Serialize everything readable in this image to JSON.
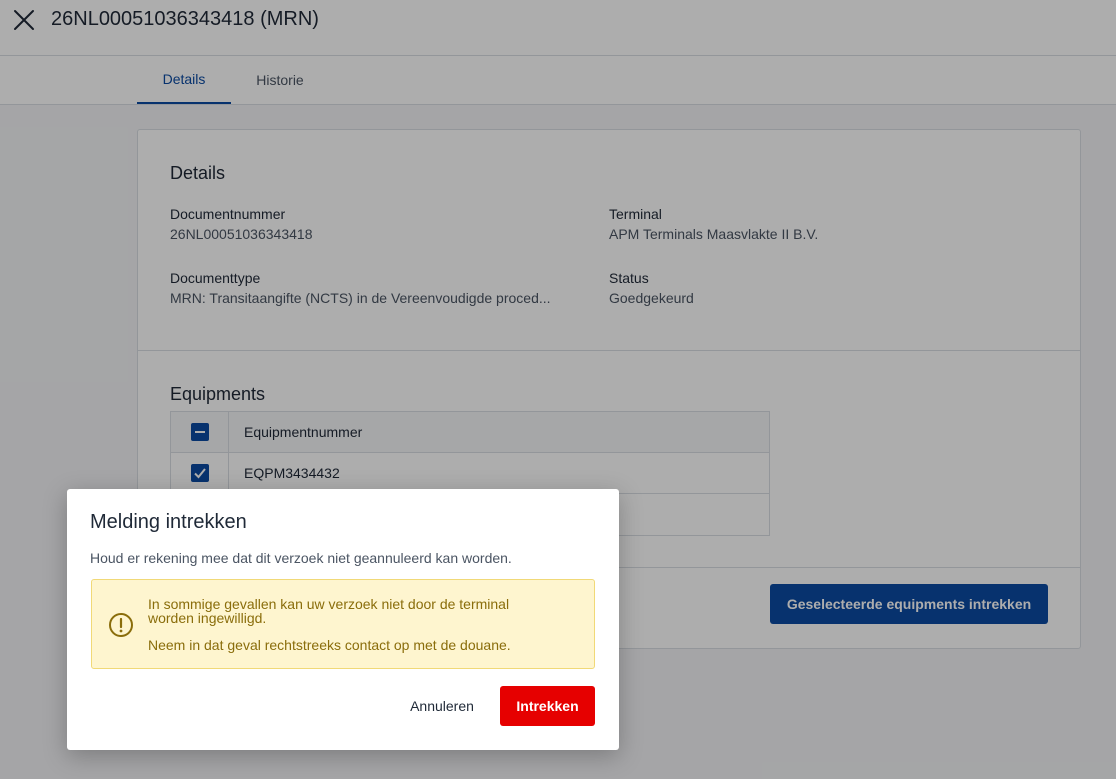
{
  "header": {
    "title": "26NL00051036343418 (MRN)",
    "close_icon": "close-icon"
  },
  "tabs": [
    {
      "label": "Details",
      "active": true
    },
    {
      "label": "Historie",
      "active": false
    }
  ],
  "details": {
    "title": "Details",
    "fields": {
      "documentnummer": {
        "label": "Documentnummer",
        "value": "26NL00051036343418"
      },
      "terminal": {
        "label": "Terminal",
        "value": "APM Terminals Maasvlakte II B.V."
      },
      "documenttype": {
        "label": "Documenttype",
        "value": "MRN: Transitaangifte (NCTS) in de Vereenvoudigde proced..."
      },
      "status": {
        "label": "Status",
        "value": "Goedgekeurd"
      }
    }
  },
  "equipments": {
    "title": "Equipments",
    "column_header": "Equipmentnummer",
    "rows": [
      {
        "number": "EQPM3434432",
        "checked": true
      },
      {
        "number": "",
        "checked": false
      }
    ],
    "withdraw_button": "Geselecteerde equipments intrekken"
  },
  "modal": {
    "title": "Melding intrekken",
    "text": "Houd er rekening mee dat dit verzoek niet geannuleerd kan worden.",
    "alert": {
      "line1": "In sommige gevallen kan uw verzoek niet door de terminal",
      "line2": "worden ingewilligd.",
      "line3": "Neem in dat geval rechtstreeks contact op met de douane."
    },
    "cancel_label": "Annuleren",
    "confirm_label": "Intrekken"
  },
  "colors": {
    "primary": "#0b4aa2",
    "danger": "#e60000",
    "warning_bg": "#fef5cf",
    "warning_text": "#8a6d0b"
  }
}
